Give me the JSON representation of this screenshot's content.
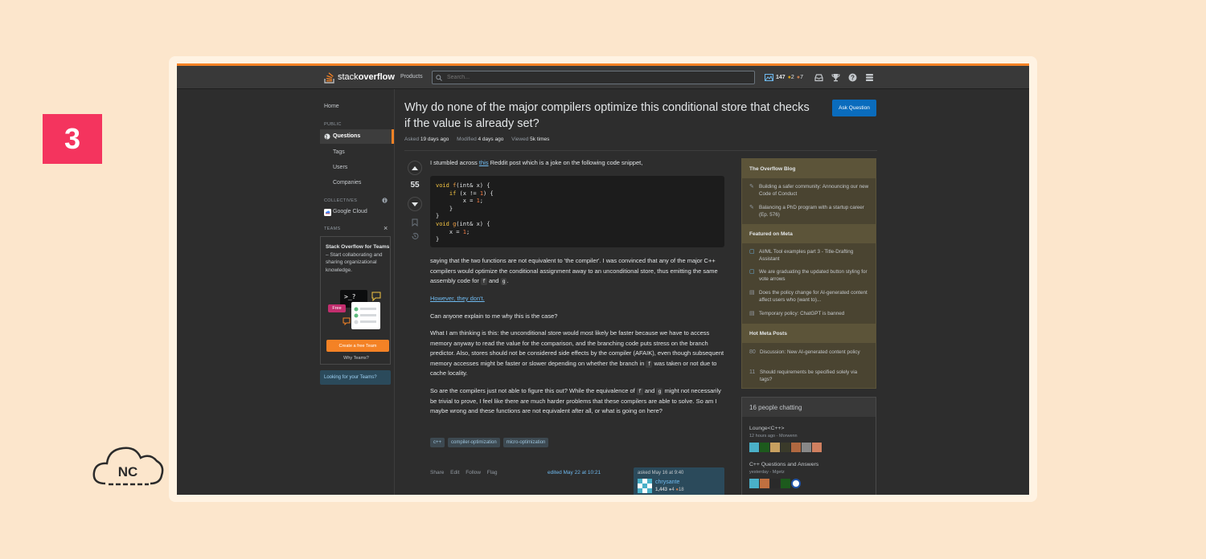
{
  "slide": {
    "number": "3",
    "logo_text": "NC"
  },
  "topbar": {
    "logo_light": "stack",
    "logo_bold": "overflow",
    "products": "Products",
    "search_placeholder": "Search...",
    "reputation": "147",
    "gold_badges": "2",
    "bronze_badges": "7"
  },
  "sidebar": {
    "home": "Home",
    "public_heading": "PUBLIC",
    "questions": "Questions",
    "tags": "Tags",
    "users": "Users",
    "companies": "Companies",
    "collectives_heading": "COLLECTIVES",
    "google_cloud": "Google Cloud",
    "teams_heading": "TEAMS",
    "teams_title": "Stack Overflow for Teams",
    "teams_desc": " – Start collaborating and sharing organizational knowledge.",
    "free_badge": "Free",
    "create_team": "Create a free Team",
    "why_teams": "Why Teams?",
    "looking_teams": "Looking for your Teams?"
  },
  "question": {
    "title": "Why do none of the major compilers optimize this conditional store that checks if the value is already set?",
    "ask_button": "Ask Question",
    "asked_label": "Asked",
    "asked_value": "19 days ago",
    "modified_label": "Modified",
    "modified_value": "4 days ago",
    "viewed_label": "Viewed",
    "viewed_value": "5k times",
    "score": "55",
    "intro_before": "I stumbled across ",
    "intro_link": "this",
    "intro_after": " Reddit post which is a joke on the following code snippet,",
    "p1_a": "saying that the two functions are not equivalent to 'the compiler'. I was convinced that any of the major C++ compilers would optimize the conditional assignment away to an unconditional store, thus emitting the same assembly code for ",
    "p1_code1": "f",
    "p1_and": " and ",
    "p1_code2": "g",
    "p1_end": ".",
    "link_however": "However, they don't.",
    "p_why": "Can anyone explain to me why this is the case?",
    "p2_a": "What I am thinking is this: the unconditional store would most likely be faster because we have to access memory anyway to read the value for the comparison, and the branching code puts stress on the branch predictor. Also, stores should not be considered side effects by the compiler (AFAIK), even though subsequent memory accesses might be faster or slower depending on whether the branch in ",
    "p2_code": "f",
    "p2_b": " was taken or not due to cache locality.",
    "p3_a": "So are the compilers just not able to figure this out? While the equivalence of ",
    "p3_code1": "f",
    "p3_and": " and ",
    "p3_code2": "g",
    "p3_b": " might not necessarily be trivial to prove, I feel like there are much harder problems that these compilers are able to solve. So am I maybe wrong and these functions are not equivalent after all, or what is going on here?",
    "tags": [
      "c++",
      "compiler-optimization",
      "micro-optimization"
    ],
    "actions": [
      "Share",
      "Edit",
      "Follow",
      "Flag"
    ],
    "edited": "edited May 22 at 10:21",
    "asked_card": "asked May 16 at 9:40",
    "author": "chrysante",
    "author_rep": "1,443",
    "author_silver": "4",
    "author_bronze": "18"
  },
  "code": {
    "l1_kw": "void",
    "l1_fn": "f",
    "l1_rest": "(int& x) {",
    "l2_kw": "if",
    "l2_a": " (x != ",
    "l2_num": "1",
    "l2_b": ") {",
    "l3_a": "x = ",
    "l3_num": "1",
    "l3_b": ";",
    "l4": "}",
    "l5": "}",
    "l6_kw": "void",
    "l6_fn": "g",
    "l6_rest": "(int& x) {",
    "l7_a": "x = ",
    "l7_num": "1",
    "l7_b": ";",
    "l8": "}"
  },
  "right": {
    "blog_heading": "The Overflow Blog",
    "blog1": "Building a safer community: Announcing our new Code of Conduct",
    "blog2": "Balancing a PhD program with a startup career (Ep. 576)",
    "meta_heading": "Featured on Meta",
    "meta1": "AI/ML Tool examples part 3 - Title-Drafting Assistant",
    "meta2": "We are graduating the updated button styling for vote arrows",
    "meta3": "Does the policy change for AI-generated content affect users who (want to)...",
    "meta4": "Temporary policy: ChatGPT is banned",
    "hot_heading": "Hot Meta Posts",
    "hot1_count": "80",
    "hot1": "Discussion: New AI-generated content policy",
    "hot2_count": "11",
    "hot2": "Should requirements be specified solely via tags?",
    "chat_heading": "16 people chatting",
    "room1": "Lounge<C++>",
    "room1_sub": "12 hours ago - Morwenn",
    "room2": "C++ Questions and Answers",
    "room2_sub": "yesterday - Mgetz"
  }
}
